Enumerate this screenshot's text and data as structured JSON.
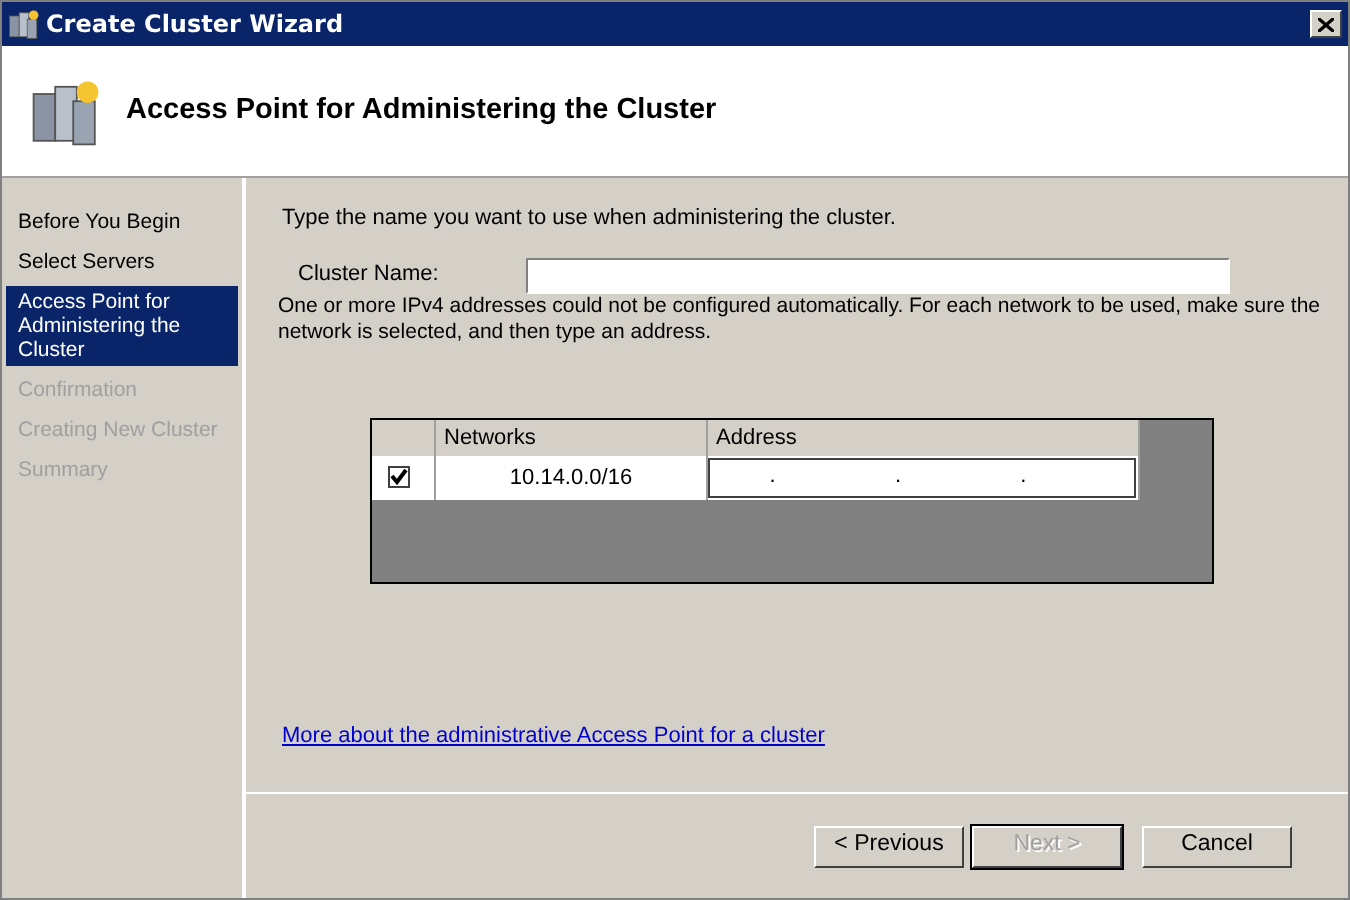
{
  "window": {
    "title": "Create Cluster Wizard"
  },
  "header": {
    "title": "Access Point for Administering the Cluster"
  },
  "steps": [
    {
      "label": "Before You Begin",
      "selected": false,
      "disabled": false
    },
    {
      "label": "Select Servers",
      "selected": false,
      "disabled": false
    },
    {
      "label": "Access Point for Administering the Cluster",
      "selected": true,
      "disabled": false
    },
    {
      "label": "Confirmation",
      "selected": false,
      "disabled": true
    },
    {
      "label": "Creating New Cluster",
      "selected": false,
      "disabled": true
    },
    {
      "label": "Summary",
      "selected": false,
      "disabled": true
    }
  ],
  "intro": "Type the name you want to use when administering the cluster.",
  "cluster_name": {
    "label": "Cluster Name:"
  },
  "note": "One or more IPv4 addresses could not be configured automatically.  For each network to be used, make sure the network is selected, and then type an address.",
  "table": {
    "columns": [
      "Networks",
      "Address"
    ],
    "rows": [
      {
        "checked": true,
        "network": "10.14.0.0/16",
        "address_separators": [
          ".",
          ".",
          "."
        ]
      }
    ]
  },
  "link": "More about the administrative Access Point for a cluster",
  "buttons": [
    {
      "label": "< Previous",
      "disabled": false,
      "default": false
    },
    {
      "label": "Next >",
      "disabled": true,
      "default": true
    },
    {
      "label": "Cancel",
      "disabled": false,
      "default": false
    }
  ]
}
